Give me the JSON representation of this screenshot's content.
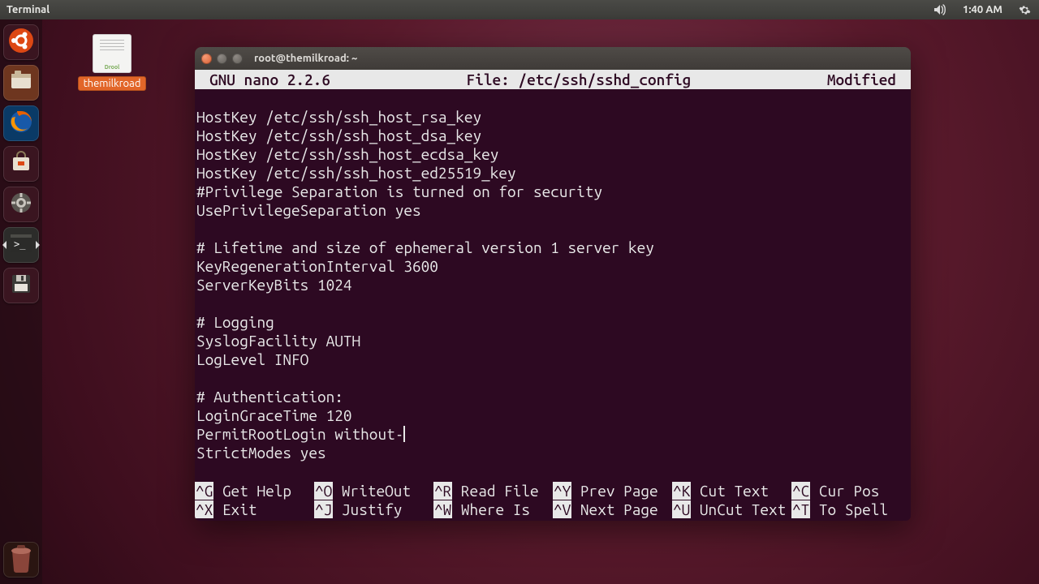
{
  "panel": {
    "app_title": "Terminal",
    "time": "1:40 AM"
  },
  "launcher": {
    "items": [
      {
        "name": "dash",
        "color": "#3a1520",
        "icon": "ubuntu"
      },
      {
        "name": "files",
        "color": "#6e361f",
        "icon": "files"
      },
      {
        "name": "firefox",
        "color": "#0a3a66",
        "icon": "firefox"
      },
      {
        "name": "software",
        "color": "#3a1520",
        "icon": "bag"
      },
      {
        "name": "settings",
        "color": "#3a1520",
        "icon": "gear"
      },
      {
        "name": "terminal",
        "color": "#2c2c2a",
        "icon": "terminal",
        "active": true
      },
      {
        "name": "disk",
        "color": "#3a1520",
        "icon": "floppy"
      }
    ]
  },
  "desktop": {
    "file_label": "themilkroad",
    "file_ext": "Drool"
  },
  "terminal_window": {
    "title": "root@themilkroad: ~"
  },
  "nano": {
    "editor_name": "GNU nano 2.2.6",
    "file_label": "File: /etc/ssh/sshd_config",
    "status": "Modified",
    "lines": [
      "",
      "HostKey /etc/ssh/ssh_host_rsa_key",
      "HostKey /etc/ssh/ssh_host_dsa_key",
      "HostKey /etc/ssh/ssh_host_ecdsa_key",
      "HostKey /etc/ssh/ssh_host_ed25519_key",
      "#Privilege Separation is turned on for security",
      "UsePrivilegeSeparation yes",
      "",
      "# Lifetime and size of ephemeral version 1 server key",
      "KeyRegenerationInterval 3600",
      "ServerKeyBits 1024",
      "",
      "# Logging",
      "SyslogFacility AUTH",
      "LogLevel INFO",
      "",
      "# Authentication:",
      "LoginGraceTime 120",
      "PermitRootLogin without-",
      "StrictModes yes"
    ],
    "cursor_line_index": 18,
    "shortcuts": [
      [
        {
          "key": "^G",
          "label": "Get Help"
        },
        {
          "key": "^O",
          "label": "WriteOut"
        },
        {
          "key": "^R",
          "label": "Read File"
        },
        {
          "key": "^Y",
          "label": "Prev Page"
        },
        {
          "key": "^K",
          "label": "Cut Text"
        },
        {
          "key": "^C",
          "label": "Cur Pos"
        }
      ],
      [
        {
          "key": "^X",
          "label": "Exit"
        },
        {
          "key": "^J",
          "label": "Justify"
        },
        {
          "key": "^W",
          "label": "Where Is"
        },
        {
          "key": "^V",
          "label": "Next Page"
        },
        {
          "key": "^U",
          "label": "UnCut Text"
        },
        {
          "key": "^T",
          "label": "To Spell"
        }
      ]
    ]
  }
}
